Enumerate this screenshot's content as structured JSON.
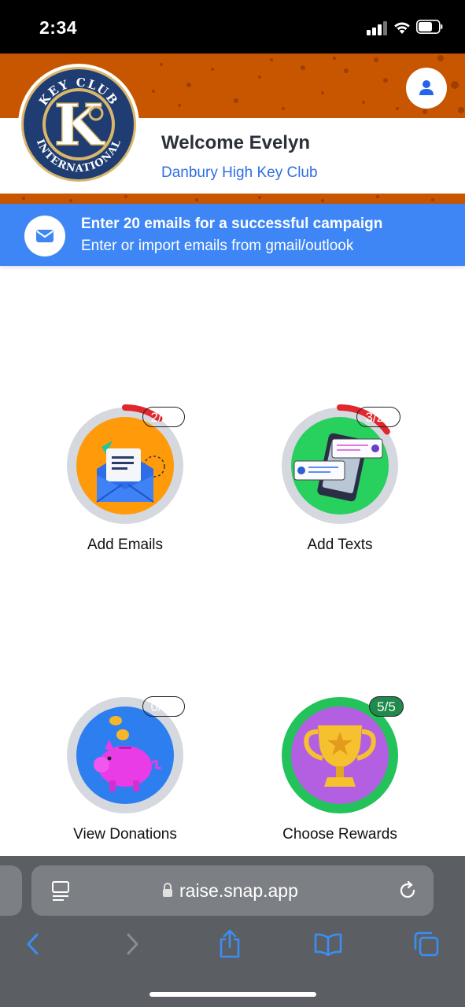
{
  "status_bar": {
    "time": "2:34"
  },
  "header": {
    "welcome": "Welcome Evelyn",
    "club_name": "Danbury High Key Club",
    "logo_text_top": "KEY CLUB",
    "logo_text_bottom": "INTERNATIONAL",
    "logo_letter": "K"
  },
  "info_banner": {
    "title": "Enter 20 emails for a successful campaign",
    "subtitle": "Enter or import emails from gmail/outlook",
    "icon": "mail-icon"
  },
  "actions": [
    {
      "label": "Add Emails",
      "badge": "2/20",
      "progress": 0.1,
      "icon": "envelope-icon"
    },
    {
      "label": "Add Texts",
      "badge": "3/20",
      "progress": 0.15,
      "icon": "phone-messages-icon"
    },
    {
      "label": "View Donations",
      "badge": "0/20",
      "progress": 0.0,
      "icon": "piggy-bank-icon"
    },
    {
      "label": "Choose Rewards",
      "badge": "5/5",
      "progress": 1.0,
      "icon": "trophy-icon"
    }
  ],
  "colors": {
    "banner": "#c85500",
    "accent_blue": "#3e86f5",
    "badge_red": "#d7262c",
    "badge_green": "#1f8a4c",
    "emails_bg": "#ff9a0a",
    "texts_bg": "#28d15e",
    "donations_bg": "#2d7ff0",
    "rewards_bg": "#b35fe2"
  },
  "browser": {
    "url": "raise.snap.app"
  }
}
